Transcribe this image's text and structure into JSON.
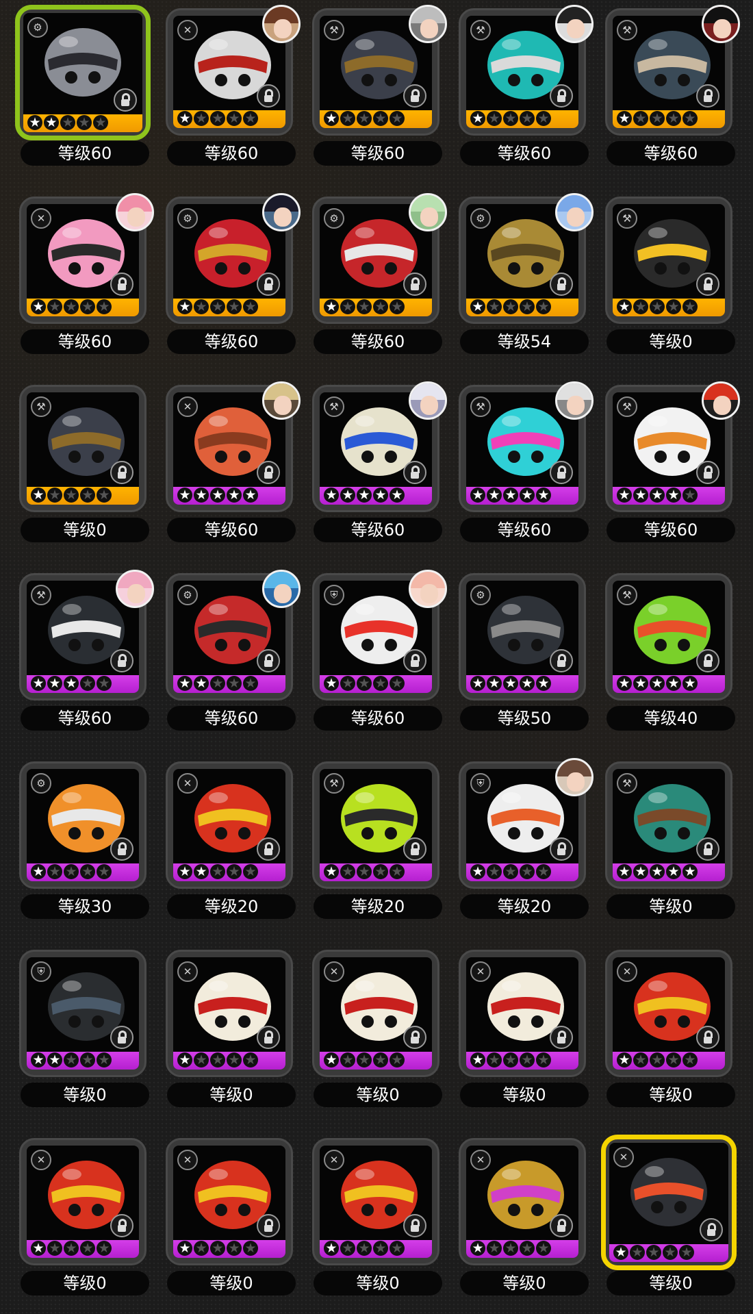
{
  "rows": [
    [
      {
        "level": "等级60",
        "stars": 2,
        "rarity": "s",
        "art": "#8a8d95",
        "art2": "#2a2a30",
        "type": "⚙",
        "portrait": null,
        "selected": "green"
      },
      {
        "level": "等级60",
        "stars": 1,
        "rarity": "s",
        "art": "#d8d8d8",
        "art2": "#b8231c",
        "type": "✕",
        "portrait": {
          "hair": "#6b3a24",
          "bg": "#c9a27d"
        },
        "selected": null
      },
      {
        "level": "等级60",
        "stars": 1,
        "rarity": "s",
        "art": "#3b3f4a",
        "art2": "#8d6b2a",
        "type": "⚒",
        "portrait": {
          "hair": "#bdbdbd",
          "bg": "#7a7a7a"
        },
        "selected": null
      },
      {
        "level": "等级60",
        "stars": 1,
        "rarity": "s",
        "art": "#1fb9b3",
        "art2": "#dadada",
        "type": "⚒",
        "portrait": {
          "hair": "#222222",
          "bg": "#dcdcdc"
        },
        "selected": null
      },
      {
        "level": "等级60",
        "stars": 1,
        "rarity": "s",
        "art": "#3a4a57",
        "art2": "#c8b8a0",
        "type": "⚒",
        "portrait": {
          "hair": "#111111",
          "bg": "#7a1f1f"
        },
        "selected": null
      }
    ],
    [
      {
        "level": "等级60",
        "stars": 1,
        "rarity": "s",
        "art": "#f29ac0",
        "art2": "#2a2a2a",
        "type": "✕",
        "portrait": {
          "hair": "#f08fa8",
          "bg": "#f7d2da"
        },
        "selected": null
      },
      {
        "level": "等级60",
        "stars": 1,
        "rarity": "s",
        "art": "#c8202b",
        "art2": "#d4a52a",
        "type": "⚙",
        "portrait": {
          "hair": "#1a1a2a",
          "bg": "#4a6a8a"
        },
        "selected": null
      },
      {
        "level": "等级60",
        "stars": 1,
        "rarity": "s",
        "art": "#c6262a",
        "art2": "#e7e7e7",
        "type": "⚙",
        "portrait": {
          "hair": "#b8e0b0",
          "bg": "#8fbf8a"
        },
        "selected": null
      },
      {
        "level": "等级54",
        "stars": 1,
        "rarity": "s",
        "art": "#a98a35",
        "art2": "#5a4820",
        "type": "⚙",
        "portrait": {
          "hair": "#7aa8e8",
          "bg": "#a9c8f0"
        },
        "selected": null
      },
      {
        "level": "等级0",
        "stars": 1,
        "rarity": "s",
        "art": "#2a2a2a",
        "art2": "#f2c024",
        "type": "⚒",
        "portrait": null,
        "selected": null
      }
    ],
    [
      {
        "level": "等级0",
        "stars": 1,
        "rarity": "s",
        "art": "#3b3f4a",
        "art2": "#8d6b2a",
        "type": "⚒",
        "portrait": null,
        "selected": null
      },
      {
        "level": "等级60",
        "stars": 5,
        "rarity": "a",
        "art": "#e0603a",
        "art2": "#8a3b1f",
        "type": "✕",
        "portrait": {
          "hair": "#d7c28a",
          "bg": "#5a4a3a"
        },
        "selected": null
      },
      {
        "level": "等级60",
        "stars": 5,
        "rarity": "a",
        "art": "#e6e2cc",
        "art2": "#2a5ad6",
        "type": "⚒",
        "portrait": {
          "hair": "#e5e5f0",
          "bg": "#9a9ab8"
        },
        "selected": null
      },
      {
        "level": "等级60",
        "stars": 5,
        "rarity": "a",
        "art": "#2fd0d6",
        "art2": "#f040b8",
        "type": "⚒",
        "portrait": {
          "hair": "#e0e0e0",
          "bg": "#888888"
        },
        "selected": null
      },
      {
        "level": "等级60",
        "stars": 4,
        "rarity": "a",
        "art": "#f2f2f2",
        "art2": "#e88a2a",
        "type": "⚒",
        "portrait": {
          "hair": "#d8321e",
          "bg": "#1f1f1f"
        },
        "selected": null
      }
    ],
    [
      {
        "level": "等级60",
        "stars": 3,
        "rarity": "a",
        "art": "#2a2e33",
        "art2": "#e8e8e8",
        "type": "⚒",
        "portrait": {
          "hair": "#f0a8c0",
          "bg": "#f6d0dc"
        },
        "selected": null
      },
      {
        "level": "等级60",
        "stars": 2,
        "rarity": "a",
        "art": "#c52a2a",
        "art2": "#2a2a2a",
        "type": "⚙",
        "portrait": {
          "hair": "#5ab6e8",
          "bg": "#2a6aa8"
        },
        "selected": null
      },
      {
        "level": "等级60",
        "stars": 1,
        "rarity": "a",
        "art": "#eeeeee",
        "art2": "#e8322a",
        "type": "⛨",
        "portrait": {
          "hair": "#f3b8a8",
          "bg": "#f8d8cc"
        },
        "selected": null
      },
      {
        "level": "等级50",
        "stars": 5,
        "rarity": "a",
        "art": "#2e3238",
        "art2": "#8a8a8a",
        "type": "⚙",
        "portrait": null,
        "selected": null
      },
      {
        "level": "等级40",
        "stars": 5,
        "rarity": "a",
        "art": "#7ad02a",
        "art2": "#e8502a",
        "type": "⚒",
        "portrait": null,
        "selected": null
      }
    ],
    [
      {
        "level": "等级30",
        "stars": 1,
        "rarity": "a",
        "art": "#f0902a",
        "art2": "#e8e8e8",
        "type": "⚙",
        "portrait": null,
        "selected": null
      },
      {
        "level": "等级20",
        "stars": 2,
        "rarity": "a",
        "art": "#d8321e",
        "art2": "#f0c020",
        "type": "✕",
        "portrait": null,
        "selected": null
      },
      {
        "level": "等级20",
        "stars": 1,
        "rarity": "a",
        "art": "#b8e020",
        "art2": "#2a2a2a",
        "type": "⚒",
        "portrait": null,
        "selected": null
      },
      {
        "level": "等级20",
        "stars": 1,
        "rarity": "a",
        "art": "#eeeeee",
        "art2": "#e8602a",
        "type": "⛨",
        "portrait": {
          "hair": "#6a4a3a",
          "bg": "#d8c8b8"
        },
        "selected": null
      },
      {
        "level": "等级0",
        "stars": 5,
        "rarity": "a",
        "art": "#2a8a7a",
        "art2": "#7a4a2a",
        "type": "⚒",
        "portrait": null,
        "selected": null
      }
    ],
    [
      {
        "level": "等级0",
        "stars": 2,
        "rarity": "a",
        "art": "#2a2d30",
        "art2": "#4a5a6a",
        "type": "⛨",
        "portrait": null,
        "selected": null
      },
      {
        "level": "等级0",
        "stars": 1,
        "rarity": "a",
        "art": "#f2ecdc",
        "art2": "#c8201e",
        "type": "✕",
        "portrait": null,
        "selected": null
      },
      {
        "level": "等级0",
        "stars": 1,
        "rarity": "a",
        "art": "#f2ecdc",
        "art2": "#c8201e",
        "type": "✕",
        "portrait": null,
        "selected": null
      },
      {
        "level": "等级0",
        "stars": 1,
        "rarity": "a",
        "art": "#f2ecdc",
        "art2": "#c8201e",
        "type": "✕",
        "portrait": null,
        "selected": null
      },
      {
        "level": "等级0",
        "stars": 1,
        "rarity": "a",
        "art": "#d8321e",
        "art2": "#f0c020",
        "type": "✕",
        "portrait": null,
        "selected": null
      }
    ],
    [
      {
        "level": "等级0",
        "stars": 1,
        "rarity": "a",
        "art": "#d8321e",
        "art2": "#f0c020",
        "type": "✕",
        "portrait": null,
        "selected": null
      },
      {
        "level": "等级0",
        "stars": 1,
        "rarity": "a",
        "art": "#d8321e",
        "art2": "#f0c020",
        "type": "✕",
        "portrait": null,
        "selected": null
      },
      {
        "level": "等级0",
        "stars": 1,
        "rarity": "a",
        "art": "#d8321e",
        "art2": "#f0c020",
        "type": "✕",
        "portrait": null,
        "selected": null
      },
      {
        "level": "等级0",
        "stars": 1,
        "rarity": "a",
        "art": "#c89a2a",
        "art2": "#d040c8",
        "type": "✕",
        "portrait": null,
        "selected": null
      },
      {
        "level": "等级0",
        "stars": 1,
        "rarity": "a",
        "art": "#2e3035",
        "art2": "#e8502a",
        "type": "✕",
        "portrait": null,
        "selected": "yellow"
      }
    ]
  ]
}
